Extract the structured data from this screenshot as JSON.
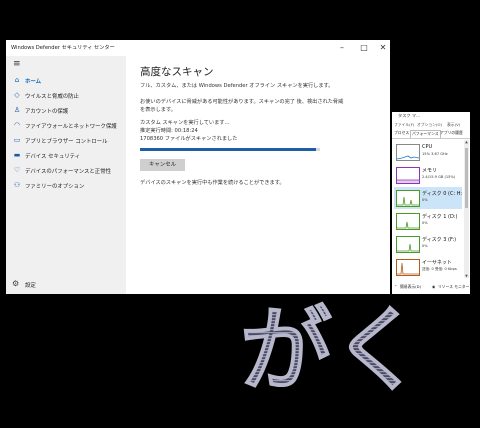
{
  "defender": {
    "window_title": "Windows Defender セキュリティ センター",
    "nav": [
      {
        "label": "ホーム",
        "icon": "home-icon",
        "active": true
      },
      {
        "label": "ウイルスと脅威の防止",
        "icon": "shield-icon"
      },
      {
        "label": "アカウントの保護",
        "icon": "person-icon"
      },
      {
        "label": "ファイアウォールとネットワーク保護",
        "icon": "wifi-icon"
      },
      {
        "label": "アプリとブラウザー コントロール",
        "icon": "app-icon"
      },
      {
        "label": "デバイス セキュリティ",
        "icon": "laptop-icon"
      },
      {
        "label": "デバイスのパフォーマンスと正常性",
        "icon": "heart-icon"
      },
      {
        "label": "ファミリーのオプション",
        "icon": "family-icon"
      }
    ],
    "settings_label": "設定",
    "main": {
      "heading": "高度なスキャン",
      "intro": "フル、カスタム、または Windows Defender オフライン スキャンを実行します。",
      "desc_line1": "お使いのデバイスに脅威がある可能性があります。スキャンの完了 後、検出された脅威",
      "desc_line2": "を表示します。",
      "status": "カスタム スキャンを実行しています...",
      "elapsed": "推定実行時間: 00:18:24",
      "files": "1708360 ファイルがスキャンされました",
      "progress": 0.98,
      "cancel_label": "キャンセル",
      "note": "デバイスのスキャンを実行中も作業を続けることができます。"
    }
  },
  "taskmanager": {
    "title": "タスク マ...",
    "menu": [
      "ファイル(F)",
      "オプション(O)",
      "表示(V)"
    ],
    "tabs": [
      "プロセス",
      "パフォーマンス",
      "アプリの履歴"
    ],
    "items": [
      {
        "name": "CPU",
        "sub": "15%  3.67 GHz",
        "color": "#1f78c8"
      },
      {
        "name": "メモリ",
        "sub": "2.4/15.9 GB (15%)",
        "color": "#8b34b4"
      },
      {
        "name": "ディスク 0 (C: H:",
        "sub": "0%",
        "color": "#4a9a2a",
        "selected": true
      },
      {
        "name": "ディスク 1 (D:)",
        "sub": "0%",
        "color": "#4a9a2a"
      },
      {
        "name": "ディスク 3 (F:)",
        "sub": "0%",
        "color": "#4a9a2a"
      },
      {
        "name": "イーサネット",
        "sub": "送信: 0 受信: 0 Kbps",
        "color": "#b45a1f"
      }
    ],
    "footer_simple": "簡易表示(D)",
    "footer_monitor": "リソース モニター"
  },
  "overlay_text": "がく"
}
